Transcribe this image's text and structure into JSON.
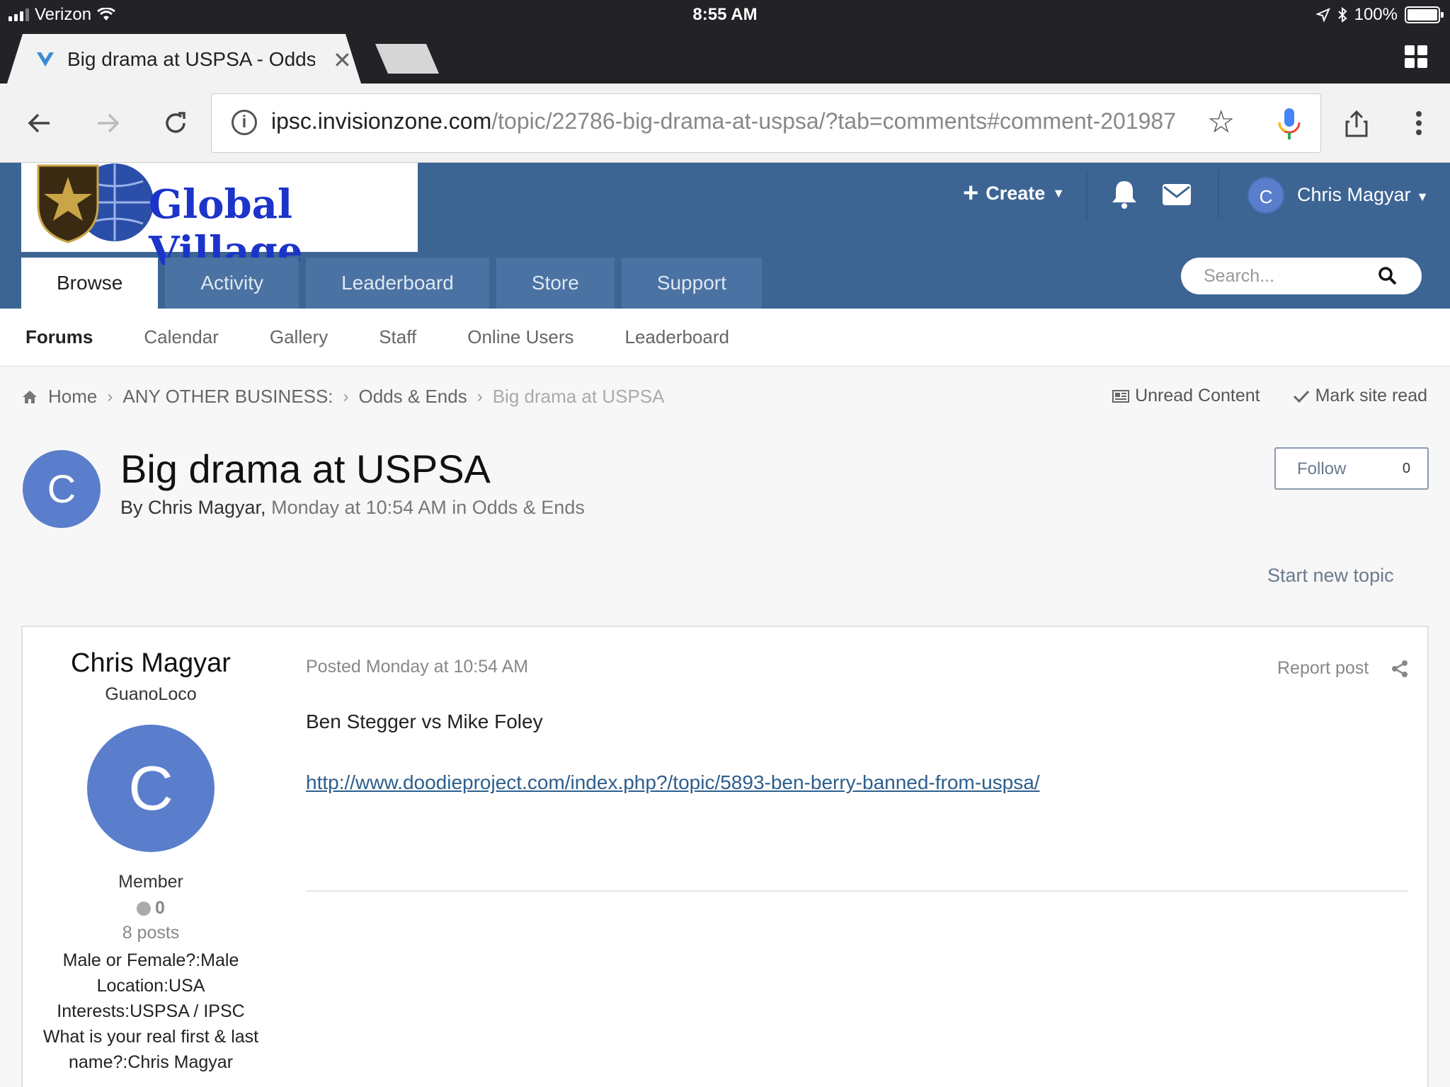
{
  "status_bar": {
    "carrier": "Verizon",
    "time": "8:55 AM",
    "battery": "100%"
  },
  "browser": {
    "tab_title": "Big drama at USPSA - Odds & Ends",
    "url_host": "ipsc.invisionzone.com",
    "url_path": "/topic/22786-big-drama-at-uspsa/?tab=comments#comment-201987"
  },
  "site": {
    "logo_text": "Global Village",
    "create_label": "Create",
    "user_initial": "C",
    "user_name": "Chris Magyar",
    "nav_tabs": [
      {
        "label": "Browse"
      },
      {
        "label": "Activity"
      },
      {
        "label": "Leaderboard"
      },
      {
        "label": "Store"
      },
      {
        "label": "Support"
      }
    ],
    "search_placeholder": "Search...",
    "sub_nav": [
      {
        "label": "Forums"
      },
      {
        "label": "Calendar"
      },
      {
        "label": "Gallery"
      },
      {
        "label": "Staff"
      },
      {
        "label": "Online Users"
      },
      {
        "label": "Leaderboard"
      }
    ]
  },
  "breadcrumb": {
    "home": "Home",
    "items": [
      "ANY OTHER BUSINESS:",
      "Odds & Ends"
    ],
    "current": "Big drama at USPSA",
    "unread_content": "Unread Content",
    "mark_site_read": "Mark site read"
  },
  "topic": {
    "author_initial": "C",
    "title": "Big drama at USPSA",
    "by_prefix": "By Chris Magyar,",
    "meta": "Monday at 10:54 AM in Odds & Ends",
    "follow_label": "Follow",
    "follow_count": "0",
    "start_new_topic": "Start new topic"
  },
  "post": {
    "author_name": "Chris Magyar",
    "author_title": "GuanoLoco",
    "author_initial": "C",
    "role": "Member",
    "reputation": "0",
    "posts": "8 posts",
    "fields": [
      "Male or Female?:Male",
      "Location:USA",
      "Interests:USPSA / IPSC",
      "What is your real first & last name?:Chris Magyar"
    ],
    "date": "Posted Monday at 10:54 AM",
    "report_label": "Report post",
    "body": "Ben Stegger vs Mike Foley",
    "link": "http://www.doodieproject.com/index.php?/topic/5893-ben-berry-banned-from-uspsa/"
  },
  "colors": {
    "header_blue": "#3d6594",
    "avatar_blue": "#5a7ecb",
    "link_blue": "#2c5f8e"
  }
}
